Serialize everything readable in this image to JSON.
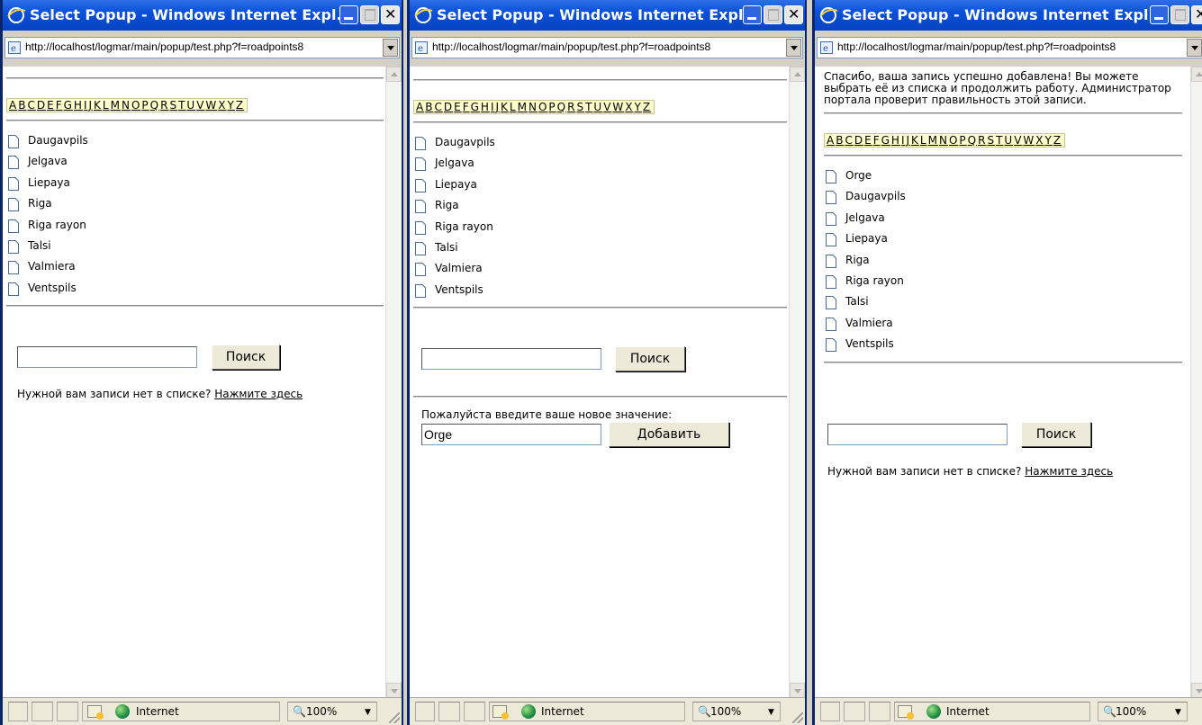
{
  "windows": [
    {
      "title": "Select Popup - Windows Internet Expl...",
      "address": "http://localhost/logmar/main/popup/test.php?f=roadpoints8",
      "message": "",
      "alphabet": [
        "A",
        "B",
        "C",
        "D",
        "E",
        "F",
        "G",
        "H",
        "I",
        "J",
        "K",
        "L",
        "M",
        "N",
        "O",
        "P",
        "Q",
        "R",
        "S",
        "T",
        "U",
        "V",
        "W",
        "X",
        "Y",
        "Z"
      ],
      "items": [
        "Daugavpils",
        "Jelgava",
        "Liepaya",
        "Riga",
        "Riga rayon",
        "Talsi",
        "Valmiera",
        "Ventspils"
      ],
      "search_button": "Поиск",
      "search_value": "",
      "missing_text": "Нужной вам записи нет в списке?",
      "missing_link": "Нажмите здесь",
      "new_value_label": "",
      "new_value": "",
      "add_button": "",
      "status_zone": "Internet",
      "zoom": "100%"
    },
    {
      "title": "Select Popup - Windows Internet Expl...",
      "address": "http://localhost/logmar/main/popup/test.php?f=roadpoints8",
      "message": "",
      "alphabet": [
        "A",
        "B",
        "C",
        "D",
        "E",
        "F",
        "G",
        "H",
        "I",
        "J",
        "K",
        "L",
        "M",
        "N",
        "O",
        "P",
        "Q",
        "R",
        "S",
        "T",
        "U",
        "V",
        "W",
        "X",
        "Y",
        "Z"
      ],
      "items": [
        "Daugavpils",
        "Jelgava",
        "Liepaya",
        "Riga",
        "Riga rayon",
        "Talsi",
        "Valmiera",
        "Ventspils"
      ],
      "search_button": "Поиск",
      "search_value": "",
      "missing_text": "",
      "missing_link": "",
      "new_value_label": "Пожалуйста введите ваше новое значение:",
      "new_value": "Orge",
      "add_button": "Добавить",
      "status_zone": "Internet",
      "zoom": "100%"
    },
    {
      "title": "Select Popup - Windows Internet Expl...",
      "address": "http://localhost/logmar/main/popup/test.php?f=roadpoints8",
      "message": "Спасибо, ваша запись успешно добавлена! Вы можете выбрать её из списка и продолжить работу. Администратор портала проверит правильность этой записи.",
      "alphabet": [
        "A",
        "B",
        "C",
        "D",
        "E",
        "F",
        "G",
        "H",
        "I",
        "J",
        "K",
        "L",
        "M",
        "N",
        "O",
        "P",
        "Q",
        "R",
        "S",
        "T",
        "U",
        "V",
        "W",
        "X",
        "Y",
        "Z"
      ],
      "items": [
        "Orge",
        "Daugavpils",
        "Jelgava",
        "Liepaya",
        "Riga",
        "Riga rayon",
        "Talsi",
        "Valmiera",
        "Ventspils"
      ],
      "search_button": "Поиск",
      "search_value": "",
      "missing_text": "Нужной вам записи нет в списке?",
      "missing_link": "Нажмите здесь",
      "new_value_label": "",
      "new_value": "",
      "add_button": "",
      "status_zone": "Internet",
      "zoom": "100%"
    }
  ],
  "colors": {
    "titlebar": "#0a50d8",
    "alphabet_bg": "#ffffcc",
    "statusbar": "#ece9d8"
  }
}
